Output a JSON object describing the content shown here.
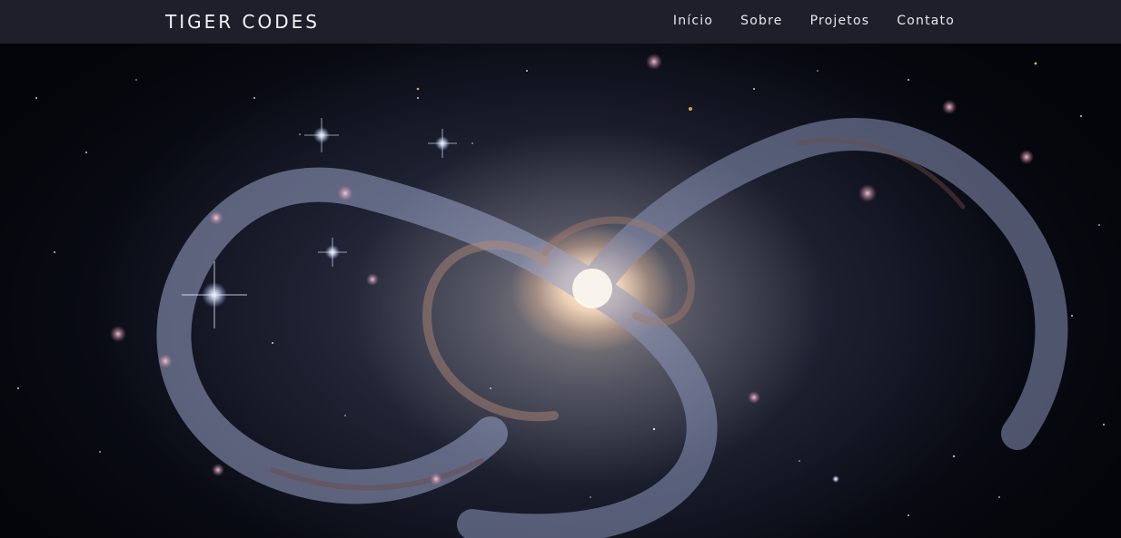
{
  "header": {
    "brand": "TIGER CODES",
    "nav": [
      {
        "label": "Início"
      },
      {
        "label": "Sobre"
      },
      {
        "label": "Projetos"
      },
      {
        "label": "Contato"
      }
    ]
  },
  "hero": {
    "image": "spiral-galaxy-photo"
  },
  "colors": {
    "header_bg": "#1f1f2c",
    "header_text": "#f2f2f5"
  }
}
